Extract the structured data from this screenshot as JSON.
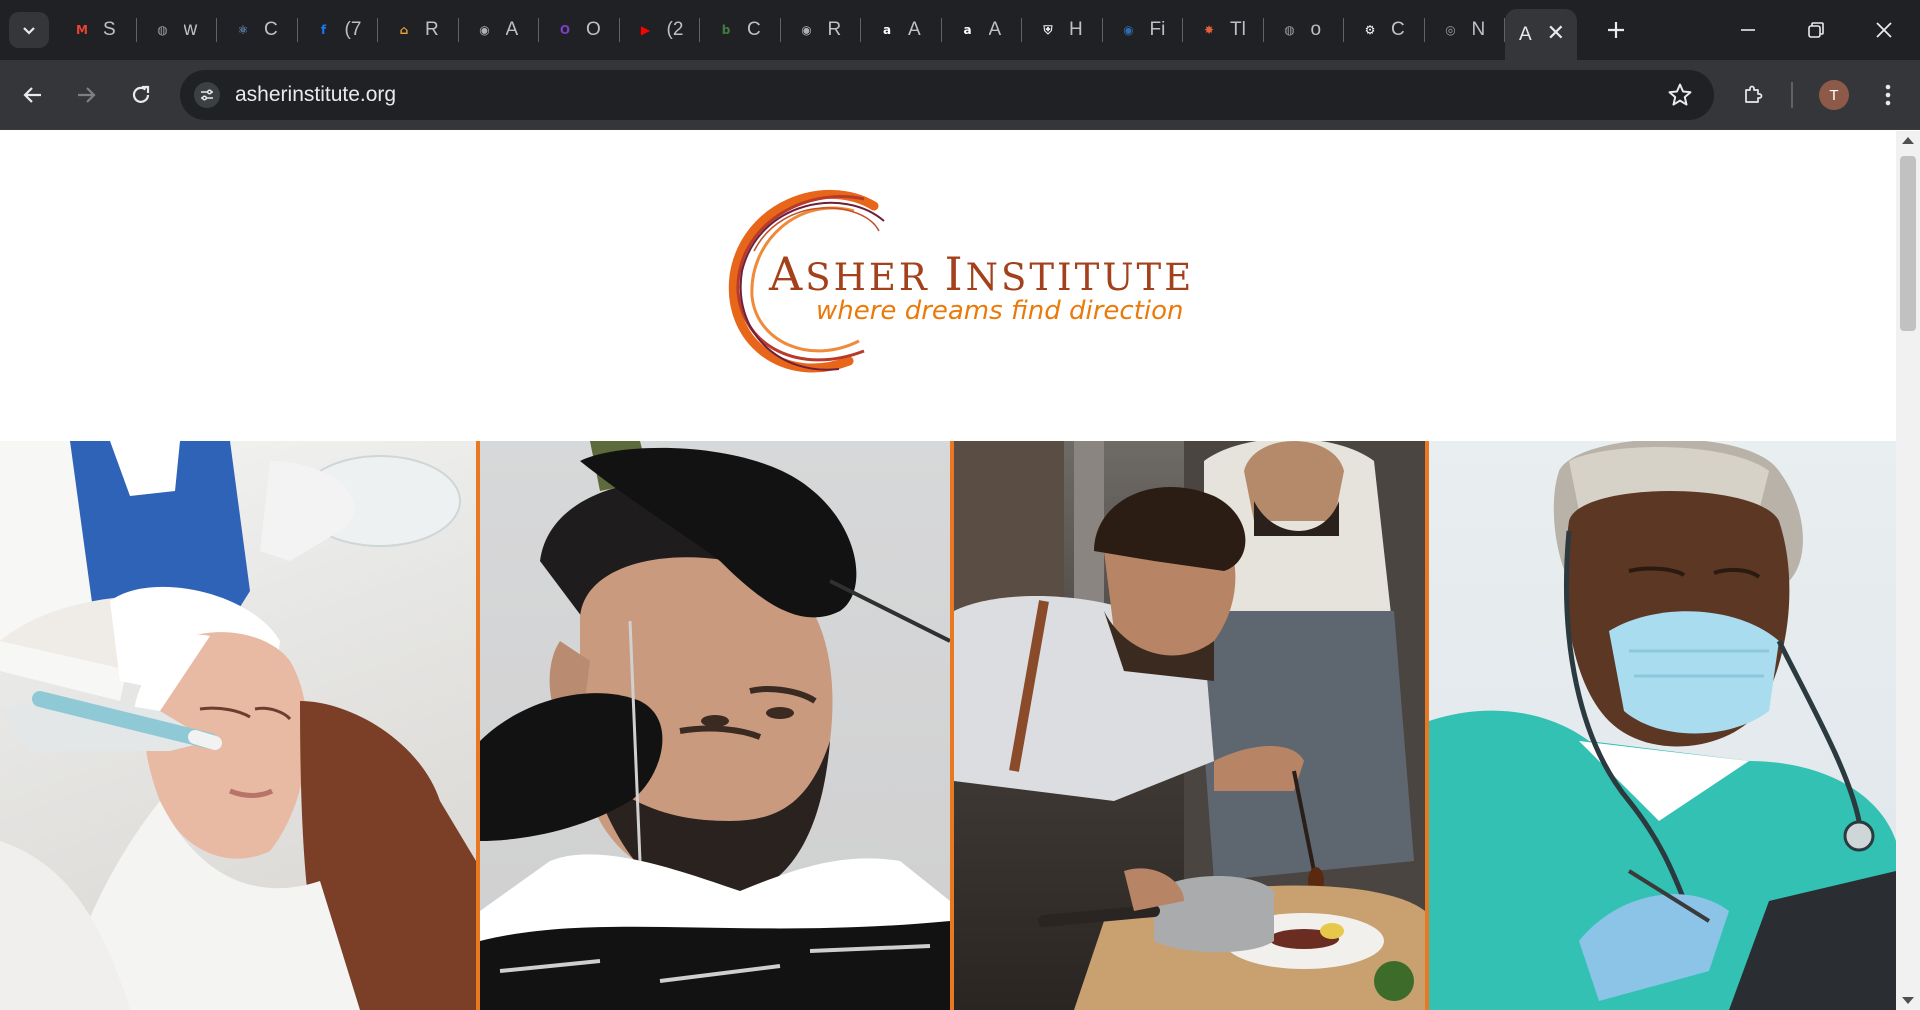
{
  "browser": {
    "tabs": [
      {
        "title": "S",
        "icon": "gmail-icon",
        "color": "#ea4335",
        "glyph": "M"
      },
      {
        "title": "w",
        "icon": "globe-icon",
        "color": "#9aa0a6",
        "glyph": "◍"
      },
      {
        "title": "C",
        "icon": "atom-icon",
        "color": "#8ab4f8",
        "glyph": "⚛"
      },
      {
        "title": "(7",
        "icon": "facebook-icon",
        "color": "#1877f2",
        "glyph": "f"
      },
      {
        "title": "R",
        "icon": "rainbow-icon",
        "color": "#e8a33c",
        "glyph": "⌂"
      },
      {
        "title": "A",
        "icon": "app-icon",
        "color": "#b0b0b0",
        "glyph": "◉"
      },
      {
        "title": "O",
        "icon": "o-icon",
        "color": "#7b3fc4",
        "glyph": "O"
      },
      {
        "title": "(2",
        "icon": "youtube-icon",
        "color": "#ff0000",
        "glyph": "▶"
      },
      {
        "title": "C",
        "icon": "c-icon",
        "color": "#3f7d3f",
        "glyph": "b"
      },
      {
        "title": "R",
        "icon": "r-icon",
        "color": "#b0b0b0",
        "glyph": "◉"
      },
      {
        "title": "A",
        "icon": "amazon-icon",
        "color": "#ffffff",
        "glyph": "a"
      },
      {
        "title": "A",
        "icon": "amazon-icon",
        "color": "#ffffff",
        "glyph": "a"
      },
      {
        "title": "H",
        "icon": "seal-icon",
        "color": "#e8eaed",
        "glyph": "⛨"
      },
      {
        "title": "Fi",
        "icon": "seal-icon",
        "color": "#2f6db3",
        "glyph": "◉"
      },
      {
        "title": "Tl",
        "icon": "star-burst-icon",
        "color": "#e0603a",
        "glyph": "✸"
      },
      {
        "title": "o",
        "icon": "globe-icon",
        "color": "#9aa0a6",
        "glyph": "◍"
      },
      {
        "title": "C",
        "icon": "chatgpt-icon",
        "color": "#ffffff",
        "glyph": "⚙"
      },
      {
        "title": "N",
        "icon": "chrome-icon",
        "color": "#9aa0a6",
        "glyph": "◎"
      }
    ],
    "active_tab": {
      "title": "A",
      "close": "✕"
    },
    "new_tab": "+",
    "url": "asherinstitute.org",
    "profile_initial": "T"
  },
  "page": {
    "logo": {
      "title_first_cap": "A",
      "title_first_rest": "SHER ",
      "title_second_cap": "I",
      "title_second_rest": "NSTITUTE",
      "tagline": "where dreams find direction"
    },
    "photos": [
      {
        "subject": "facial treatment"
      },
      {
        "subject": "barber beard trim"
      },
      {
        "subject": "chef plating dish"
      },
      {
        "subject": "nurse with stethoscope"
      }
    ]
  }
}
